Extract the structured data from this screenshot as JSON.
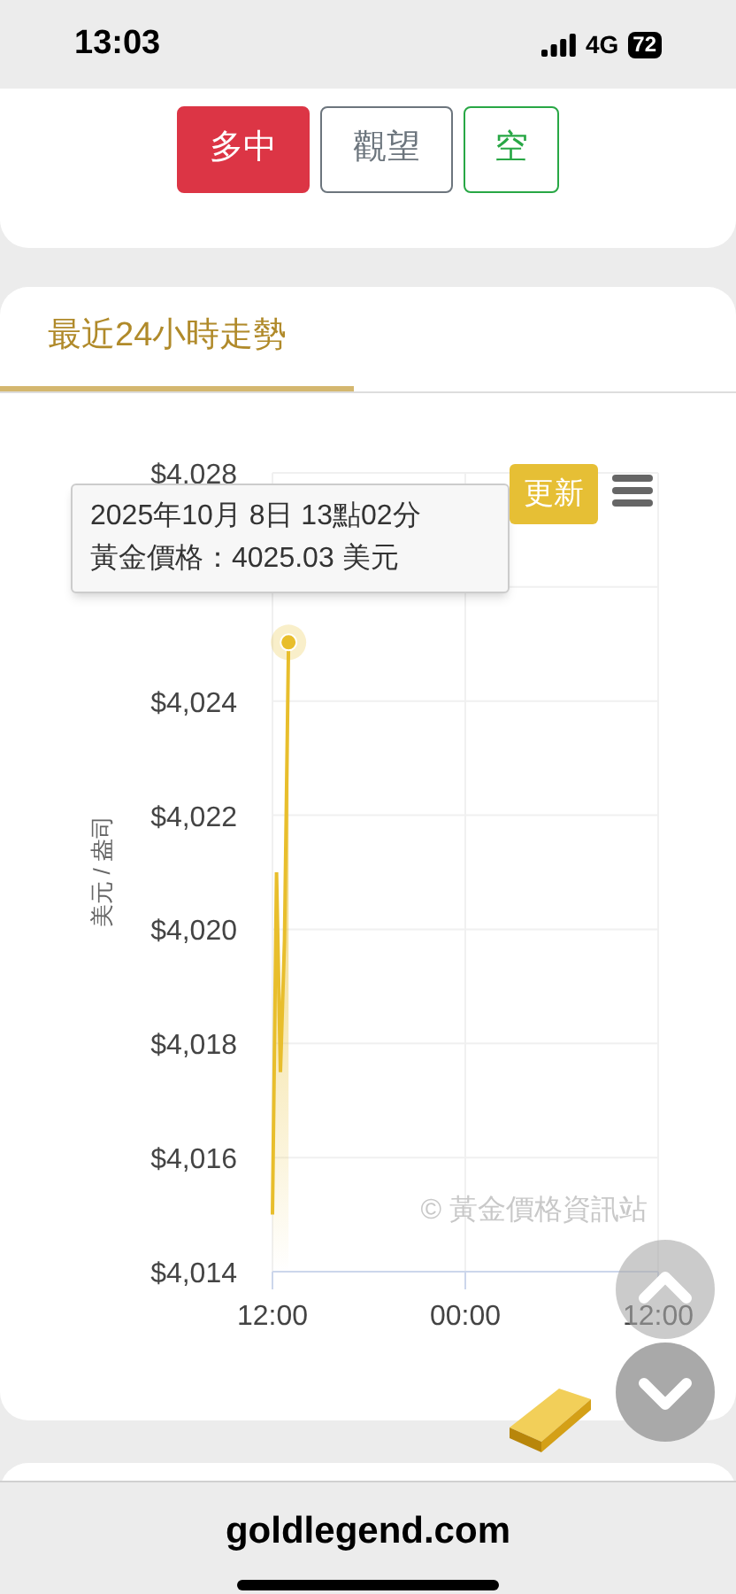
{
  "status_bar": {
    "time": "13:03",
    "network": "4G",
    "battery": "72"
  },
  "signal_buttons": [
    {
      "label": "多中",
      "selected": true,
      "color": "#dc3545"
    },
    {
      "label": "觀望",
      "selected": false,
      "color": "#6c757d"
    },
    {
      "label": "空",
      "selected": false,
      "color": "#28a745"
    }
  ],
  "trend_card": {
    "tabs": [
      {
        "label": "最近24小時走勢",
        "selected": true
      }
    ],
    "refresh_button": "更新",
    "tooltip": {
      "line_1": "2025年10月 8日 13點02分",
      "line_2": "黃金價格：4025.03 美元"
    },
    "credit": "© 黃金價格資訊站",
    "chart_data": {
      "type": "area",
      "ylabel": "美元 / 盎司",
      "grid": true,
      "categories": [
        "12:00",
        null,
        null,
        null,
        null,
        null,
        null,
        null,
        null,
        null,
        null,
        null,
        null,
        null,
        null,
        null,
        null,
        null,
        null,
        null,
        null,
        null,
        null,
        null,
        null,
        null,
        null,
        null,
        null,
        null,
        null,
        null,
        null,
        null,
        null,
        null,
        null,
        null,
        null,
        null,
        null,
        null,
        null,
        null,
        null,
        null,
        null,
        null,
        "00:00",
        null,
        null,
        null,
        null,
        null,
        null,
        null,
        null,
        null,
        null,
        null,
        null,
        null,
        null,
        null,
        null,
        null,
        null,
        null,
        null,
        null,
        null,
        null,
        null,
        null,
        null,
        null,
        null,
        null,
        null,
        null,
        null,
        null,
        null,
        null,
        null,
        null,
        null,
        null,
        null,
        null,
        null,
        null,
        null,
        null,
        null,
        null,
        "12:00"
      ],
      "series": [
        {
          "color": "#e8be2c",
          "values": [
            4015,
            4021,
            4017.5,
            4019.8,
            4025.03,
            null,
            null,
            null,
            null,
            null,
            null,
            null,
            null,
            null,
            null,
            null,
            null,
            null,
            null,
            null,
            null,
            null,
            null,
            null,
            null,
            null,
            null,
            null,
            null,
            null,
            null,
            null,
            null,
            null,
            null,
            null,
            null,
            null,
            null,
            null,
            null,
            null,
            null,
            null,
            null,
            null,
            null,
            null,
            null,
            null,
            null,
            null,
            null,
            null,
            null,
            null,
            null,
            null,
            null,
            null,
            null,
            null,
            null,
            null,
            null,
            null,
            null,
            null,
            null,
            null,
            null,
            null,
            null,
            null,
            null,
            null,
            null,
            null,
            null,
            null,
            null,
            null,
            null,
            null,
            null,
            null,
            null,
            null,
            null,
            null,
            null,
            null,
            null,
            null,
            null,
            null,
            null
          ]
        }
      ],
      "ylim": [
        4014,
        4028
      ],
      "yticks": [
        {
          "value": 4014,
          "label": "$4,014"
        },
        {
          "value": 4016,
          "label": "$4,016"
        },
        {
          "value": 4018,
          "label": "$4,018"
        },
        {
          "value": 4020,
          "label": "$4,020"
        },
        {
          "value": 4022,
          "label": "$4,022"
        },
        {
          "value": 4024,
          "label": "$4,024"
        },
        {
          "value": 4028,
          "label": "$4,028"
        }
      ]
    }
  },
  "footer": {
    "url": "goldlegend.com"
  }
}
